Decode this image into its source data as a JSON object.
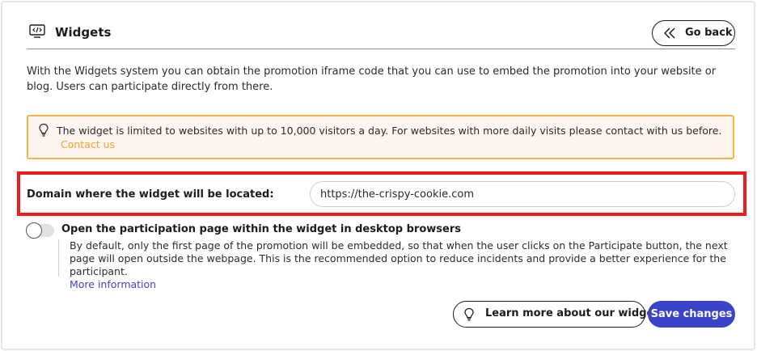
{
  "header": {
    "title": "Widgets",
    "icon": "code-window-icon",
    "back_label": "Go back"
  },
  "intro": {
    "text": "With the Widgets system you can obtain the promotion iframe code that you can use to embed the promotion into your website or blog. Users can participate directly from there."
  },
  "alert": {
    "icon": "lightbulb-icon",
    "text": "The widget is limited to websites with up to 10,000 visitors a day. For websites with more daily visits please contact with us before.",
    "link": "Contact us"
  },
  "domain": {
    "label": "Domain where the widget will be located:",
    "value": "https://the-crispy-cookie.com"
  },
  "option": {
    "title": "Open the participation page within the widget in desktop browsers",
    "enabled": false,
    "description": "By default, only the first page of the promotion will be embedded, so that when the user clicks on the Participate button, the next page will open outside the webpage. This is the recommended option to reduce incidents and provide a better experience for the participant.",
    "more_link": "More information"
  },
  "footer": {
    "learn_label": "Learn more about our widgets",
    "save_label": "Save changes"
  },
  "colors": {
    "accent": "#3b43c9",
    "alert_border": "#f3b24a",
    "alert_bg": "#fef5ee",
    "highlight": "#ee1c1c"
  }
}
